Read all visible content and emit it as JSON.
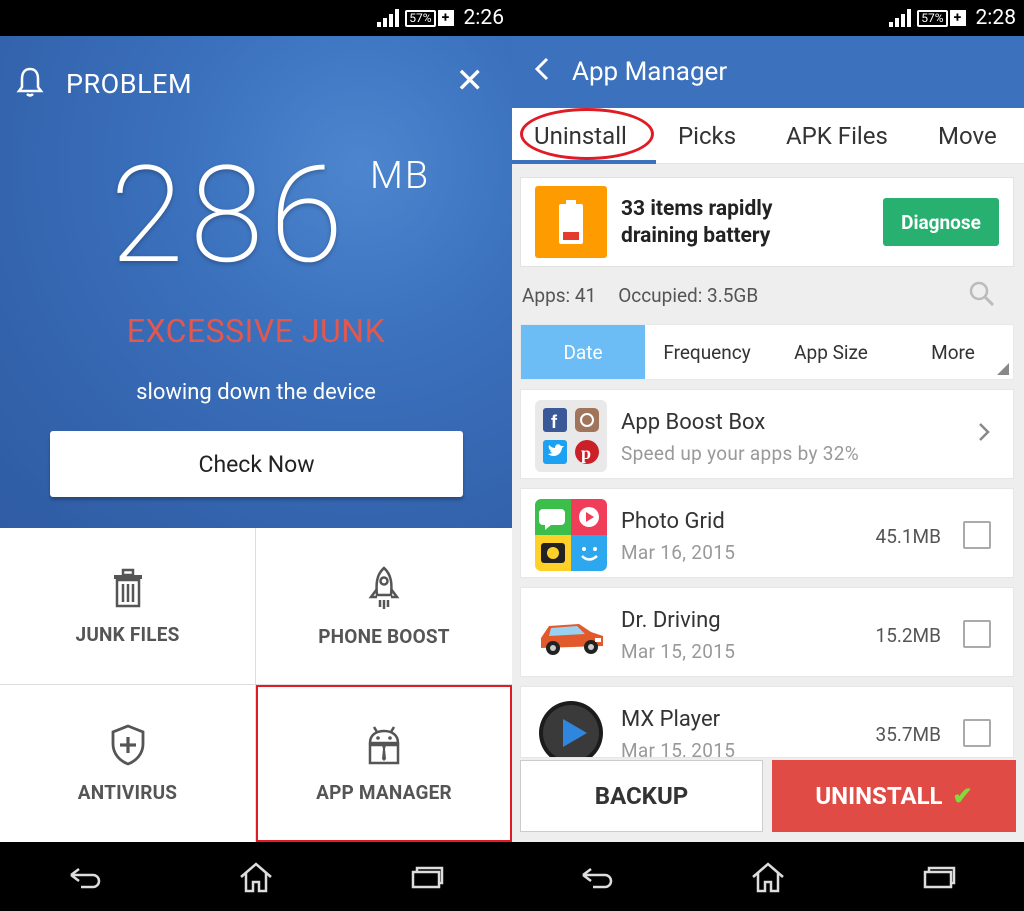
{
  "left_status": {
    "battery": "57%",
    "time": "2:26"
  },
  "right_status": {
    "battery": "57%",
    "time": "2:28"
  },
  "left": {
    "header_title": "PROBLEM",
    "close_label": "✕",
    "junk_size": "286",
    "junk_unit": "MB",
    "warning": "EXCESSIVE JUNK",
    "subtext": "slowing down the device",
    "check_button": "Check Now",
    "tiles": {
      "junk_files": "JUNK FILES",
      "phone_boost": "PHONE BOOST",
      "antivirus": "ANTIVIRUS",
      "app_manager": "APP MANAGER"
    }
  },
  "right": {
    "title": "App Manager",
    "tabs": [
      "Uninstall",
      "Picks",
      "APK Files",
      "Move"
    ],
    "battery_card": {
      "line1": "33 items rapidly",
      "line2": "draining battery",
      "button": "Diagnose"
    },
    "stats": {
      "apps": "Apps: 41",
      "occupied": "Occupied: 3.5GB"
    },
    "sort": [
      "Date",
      "Frequency",
      "App Size",
      "More"
    ],
    "promo": {
      "name": "App Boost Box",
      "sub": "Speed up your apps by 32%"
    },
    "apps": [
      {
        "name": "Photo Grid",
        "date": "Mar 16, 2015",
        "size": "45.1MB"
      },
      {
        "name": "Dr. Driving",
        "date": "Mar 15, 2015",
        "size": "15.2MB"
      },
      {
        "name": "MX Player",
        "date": "Mar 15, 2015",
        "size": "35.7MB"
      }
    ],
    "backup_button": "BACKUP",
    "uninstall_button": "UNINSTALL"
  },
  "colors": {
    "primary_blue": "#3b71bd",
    "warning_red": "#e2584f",
    "diagnose_green": "#27b06f",
    "uninstall_red": "#e14b45",
    "highlight_red": "#e01b24",
    "sort_active": "#6cbcf6"
  }
}
